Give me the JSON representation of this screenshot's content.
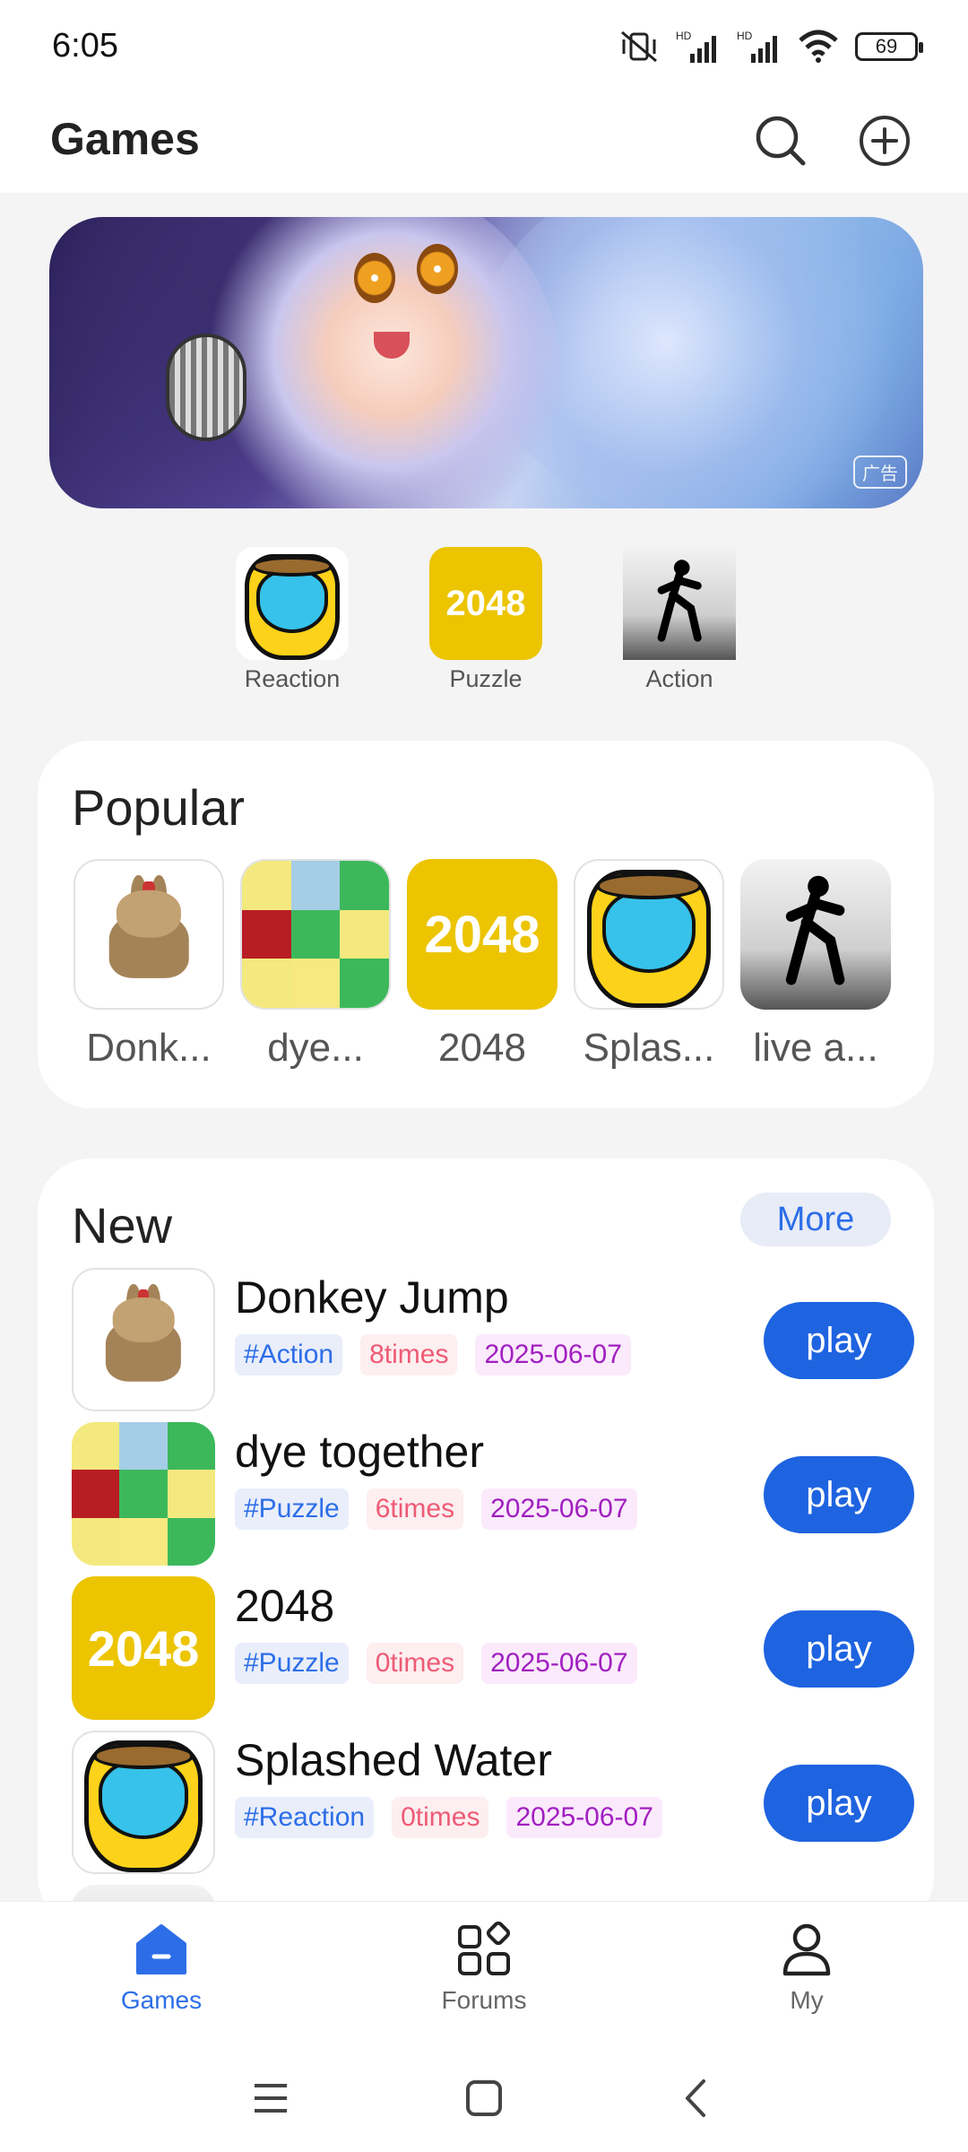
{
  "status": {
    "time": "6:05",
    "battery": "69"
  },
  "header": {
    "title": "Games"
  },
  "banner": {
    "ad_label": "广告"
  },
  "categories": [
    {
      "label": "Reaction",
      "art": "splash"
    },
    {
      "label": "Puzzle",
      "art": "2048"
    },
    {
      "label": "Action",
      "art": "action"
    }
  ],
  "popular": {
    "title": "Popular",
    "items": [
      {
        "label": "Donk...",
        "art": "donkey"
      },
      {
        "label": "dye...",
        "art": "dye"
      },
      {
        "label": "2048",
        "art": "2048"
      },
      {
        "label": "Splas...",
        "art": "splash"
      },
      {
        "label": "live a...",
        "art": "action"
      }
    ]
  },
  "new_section": {
    "title": "New",
    "more_label": "More",
    "play_label": "play",
    "games": [
      {
        "name": "Donkey Jump",
        "category": "#Action",
        "times": "8times",
        "date": "2025-06-07",
        "art": "donkey"
      },
      {
        "name": "dye together",
        "category": "#Puzzle",
        "times": "6times",
        "date": "2025-06-07",
        "art": "dye"
      },
      {
        "name": "2048",
        "category": "#Puzzle",
        "times": "0times",
        "date": "2025-06-07",
        "art": "2048"
      },
      {
        "name": "Splashed Water",
        "category": "#Reaction",
        "times": "0times",
        "date": "2025-06-07",
        "art": "splash"
      }
    ]
  },
  "art_text": {
    "tile_2048": "2048"
  },
  "bottom_nav": [
    {
      "label": "Games",
      "icon": "games-icon",
      "active": true
    },
    {
      "label": "Forums",
      "icon": "forums-icon",
      "active": false
    },
    {
      "label": "My",
      "icon": "profile-icon",
      "active": false
    }
  ],
  "colors": {
    "accent": "#1e63e0",
    "times": "#ee5b75",
    "date": "#a11fc0",
    "tile_2048": "#ecc400"
  }
}
